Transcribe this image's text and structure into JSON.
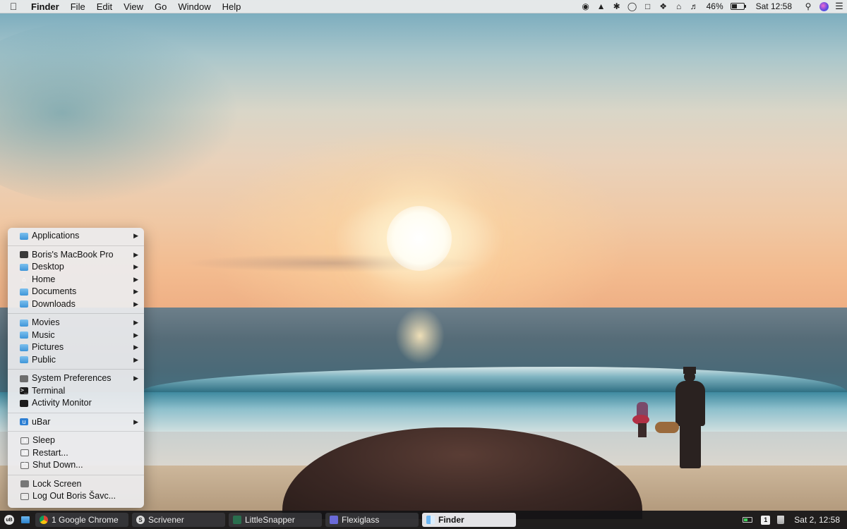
{
  "menubar": {
    "app_name": "Finder",
    "menus": [
      "File",
      "Edit",
      "View",
      "Go",
      "Window",
      "Help"
    ],
    "battery_percent": "46%",
    "battery_level": 0.46,
    "clock": "Sat 12:58",
    "status_icons": [
      "record-icon",
      "hat-icon",
      "bluetooth-icon",
      "circle-icon",
      "display-icon",
      "dropbox-icon",
      "wifi-icon",
      "volume-icon"
    ]
  },
  "ubar_menu": {
    "groups": [
      [
        {
          "label": "Applications",
          "icon": "folder-icon",
          "submenu": true
        }
      ],
      [
        {
          "label": "Boris's MacBook Pro",
          "icon": "laptop-icon",
          "submenu": true
        },
        {
          "label": "Desktop",
          "icon": "folder-icon",
          "submenu": true
        },
        {
          "label": "Home",
          "icon": "home-icon",
          "submenu": true
        },
        {
          "label": "Documents",
          "icon": "folder-icon",
          "submenu": true
        },
        {
          "label": "Downloads",
          "icon": "folder-icon",
          "submenu": true
        }
      ],
      [
        {
          "label": "Movies",
          "icon": "folder-icon",
          "submenu": true
        },
        {
          "label": "Music",
          "icon": "folder-icon",
          "submenu": true
        },
        {
          "label": "Pictures",
          "icon": "folder-icon",
          "submenu": true
        },
        {
          "label": "Public",
          "icon": "folder-icon",
          "submenu": true
        }
      ],
      [
        {
          "label": "System Preferences",
          "icon": "gear-icon",
          "submenu": true
        },
        {
          "label": "Terminal",
          "icon": "terminal-icon",
          "submenu": false
        },
        {
          "label": "Activity Monitor",
          "icon": "activity-monitor-icon",
          "submenu": false
        }
      ],
      [
        {
          "label": "uBar",
          "icon": "ubar-icon",
          "submenu": true
        }
      ],
      [
        {
          "label": "Sleep",
          "icon": "sleep-icon",
          "submenu": false
        },
        {
          "label": "Restart...",
          "icon": "restart-icon",
          "submenu": false
        },
        {
          "label": "Shut Down...",
          "icon": "power-icon",
          "submenu": false
        }
      ],
      [
        {
          "label": "Lock Screen",
          "icon": "lock-icon",
          "submenu": false
        },
        {
          "label": "Log Out Boris Šavc...",
          "icon": "logout-icon",
          "submenu": false
        }
      ]
    ]
  },
  "taskbar": {
    "apps": [
      {
        "label": "1 Google Chrome",
        "icon": "chrome-icon",
        "active": false
      },
      {
        "label": "Scrivener",
        "icon": "scrivener-icon",
        "active": false
      },
      {
        "label": "LittleSnapper",
        "icon": "littlesnapper-icon",
        "active": false
      },
      {
        "label": "Flexiglass",
        "icon": "flexiglass-icon",
        "active": false
      },
      {
        "label": "Finder",
        "icon": "finder-icon",
        "active": true
      }
    ],
    "badge_count": "1",
    "clock": "Sat 2, 12:58"
  }
}
